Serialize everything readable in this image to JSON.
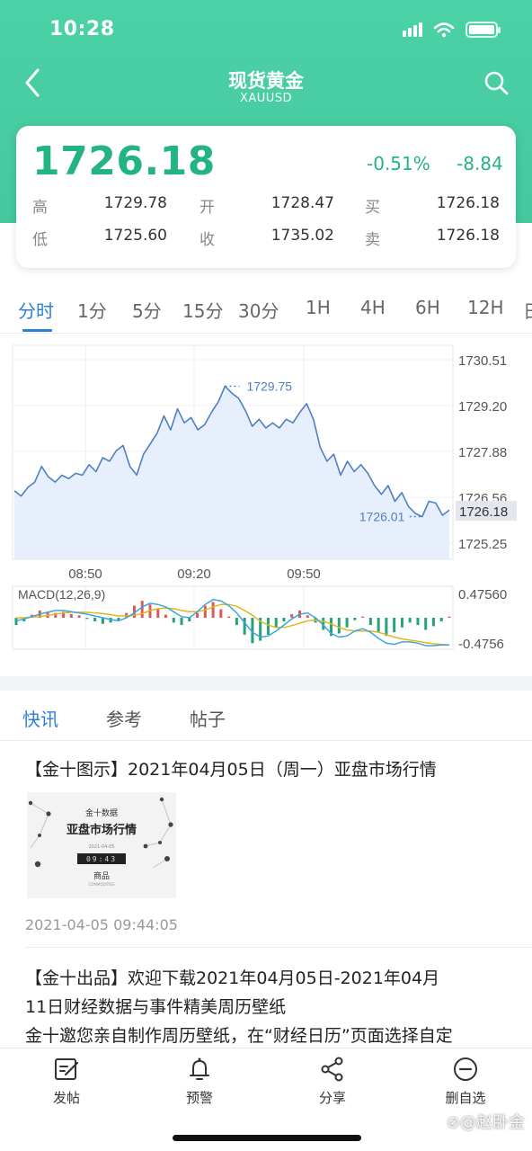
{
  "status_bar": {
    "time": "10:28"
  },
  "nav": {
    "title": "现货黄金",
    "subtitle": "XAUUSD"
  },
  "quote": {
    "price": "1726.18",
    "change_pct": "-0.51%",
    "change": "-8.84",
    "high_label": "高",
    "high": "1729.78",
    "open_label": "开",
    "open": "1728.47",
    "bid_label": "买",
    "bid": "1726.18",
    "low_label": "低",
    "low": "1725.60",
    "close_label": "收",
    "close": "1735.02",
    "ask_label": "卖",
    "ask": "1726.18"
  },
  "periods": [
    "分时",
    "1分",
    "5分",
    "15分",
    "30分",
    "1H",
    "4H",
    "6H",
    "12H",
    "日"
  ],
  "colors": {
    "accent": "#24b385",
    "header": "#4bd2a6",
    "active": "#2e7fd6",
    "macd_up": "#e25656",
    "macd_down": "#26a17a"
  },
  "chart_data": {
    "type": "line",
    "y_ticks": [
      "1730.51",
      "1729.20",
      "1727.88",
      "1726.56",
      "1725.25"
    ],
    "ylim": [
      1725.25,
      1730.51
    ],
    "x_ticks": [
      "08:50",
      "09:20",
      "09:50"
    ],
    "current_value": "1726.18",
    "max_label": "1729.75",
    "min_label": "1726.01",
    "values": [
      1726.75,
      1726.6,
      1726.85,
      1727.0,
      1727.45,
      1727.15,
      1727.0,
      1727.2,
      1727.1,
      1727.25,
      1727.2,
      1727.5,
      1727.3,
      1727.7,
      1727.6,
      1727.9,
      1728.05,
      1727.45,
      1727.2,
      1727.8,
      1728.1,
      1728.4,
      1728.9,
      1728.5,
      1729.1,
      1728.7,
      1728.85,
      1728.5,
      1728.65,
      1729.0,
      1729.3,
      1729.75,
      1729.55,
      1729.4,
      1729.05,
      1728.6,
      1728.8,
      1728.55,
      1728.7,
      1728.55,
      1728.8,
      1728.7,
      1729.0,
      1729.25,
      1728.8,
      1728.0,
      1727.6,
      1727.8,
      1727.2,
      1727.6,
      1727.3,
      1727.5,
      1727.25,
      1726.9,
      1726.65,
      1726.9,
      1726.45,
      1726.7,
      1726.3,
      1726.1,
      1726.01,
      1726.45,
      1726.4,
      1726.05,
      1726.2
    ],
    "macd": {
      "label": "MACD(12,26,9)",
      "upper": "0.47560",
      "lower": "-0.4756",
      "hist": [
        -0.12,
        -0.06,
        0.05,
        0.12,
        0.1,
        0.08,
        0.1,
        0.06,
        0.04,
        -0.02,
        -0.06,
        -0.1,
        -0.08,
        -0.05,
        0.08,
        0.2,
        0.28,
        0.22,
        0.14,
        0.05,
        -0.08,
        -0.12,
        -0.06,
        0.08,
        0.2,
        0.26,
        0.14,
        0.02,
        -0.12,
        -0.28,
        -0.42,
        -0.38,
        -0.28,
        -0.16,
        -0.06,
        0.06,
        0.12,
        0.04,
        -0.08,
        -0.2,
        -0.3,
        -0.26,
        -0.16,
        -0.04,
        0.02,
        -0.12,
        -0.24,
        -0.3,
        -0.24,
        -0.16,
        -0.08,
        -0.12,
        -0.2,
        -0.14,
        -0.06,
        0.02
      ],
      "dif": [
        -0.05,
        -0.02,
        0.02,
        0.06,
        0.09,
        0.12,
        0.12,
        0.1,
        0.08,
        0.06,
        0.03,
        0.0,
        -0.03,
        -0.05,
        0.0,
        0.08,
        0.18,
        0.24,
        0.22,
        0.18,
        0.1,
        0.02,
        0.0,
        0.1,
        0.22,
        0.3,
        0.28,
        0.2,
        0.08,
        -0.08,
        -0.24,
        -0.32,
        -0.3,
        -0.22,
        -0.12,
        -0.02,
        0.06,
        0.08,
        0.0,
        -0.12,
        -0.26,
        -0.32,
        -0.3,
        -0.22,
        -0.18,
        -0.24,
        -0.34,
        -0.42,
        -0.44,
        -0.4,
        -0.4,
        -0.42,
        -0.46,
        -0.46,
        -0.45,
        -0.45
      ],
      "dea": [
        0.0,
        0.0,
        0.01,
        0.02,
        0.04,
        0.06,
        0.08,
        0.09,
        0.09,
        0.09,
        0.08,
        0.07,
        0.05,
        0.03,
        0.03,
        0.04,
        0.07,
        0.12,
        0.15,
        0.16,
        0.15,
        0.12,
        0.1,
        0.1,
        0.13,
        0.18,
        0.22,
        0.22,
        0.19,
        0.12,
        0.04,
        -0.06,
        -0.12,
        -0.16,
        -0.16,
        -0.13,
        -0.09,
        -0.05,
        -0.04,
        -0.06,
        -0.1,
        -0.16,
        -0.2,
        -0.22,
        -0.22,
        -0.22,
        -0.24,
        -0.28,
        -0.32,
        -0.35,
        -0.37,
        -0.39,
        -0.41,
        -0.43,
        -0.44,
        -0.45
      ]
    }
  },
  "news_tabs": [
    "快讯",
    "参考",
    "帖子"
  ],
  "news": [
    {
      "title": "【金十图示】2021年04月05日（周一）亚盘市场行情",
      "thumb_top": "金十数据",
      "thumb_title": "亚盘市场行情",
      "thumb_date": "2021-04-05",
      "thumb_time": "09:43",
      "thumb_tag": "商品",
      "thumb_tag_en": "COMMODITIES",
      "time": "2021-04-05 09:44:05"
    },
    {
      "line1": "【金十出品】欢迎下载2021年04月05日-2021年04月",
      "line2": "11日财经数据与事件精美周历壁纸",
      "line3": "金十邀您亲自制作周历壁纸，在“财经日历”页面选择自定"
    }
  ],
  "toolbar": [
    {
      "label": "发帖",
      "icon": "edit-icon"
    },
    {
      "label": "预警",
      "icon": "bell-icon"
    },
    {
      "label": "分享",
      "icon": "share-icon"
    },
    {
      "label": "删自选",
      "icon": "minus-circle-icon"
    }
  ],
  "watermark": "赵卧金"
}
